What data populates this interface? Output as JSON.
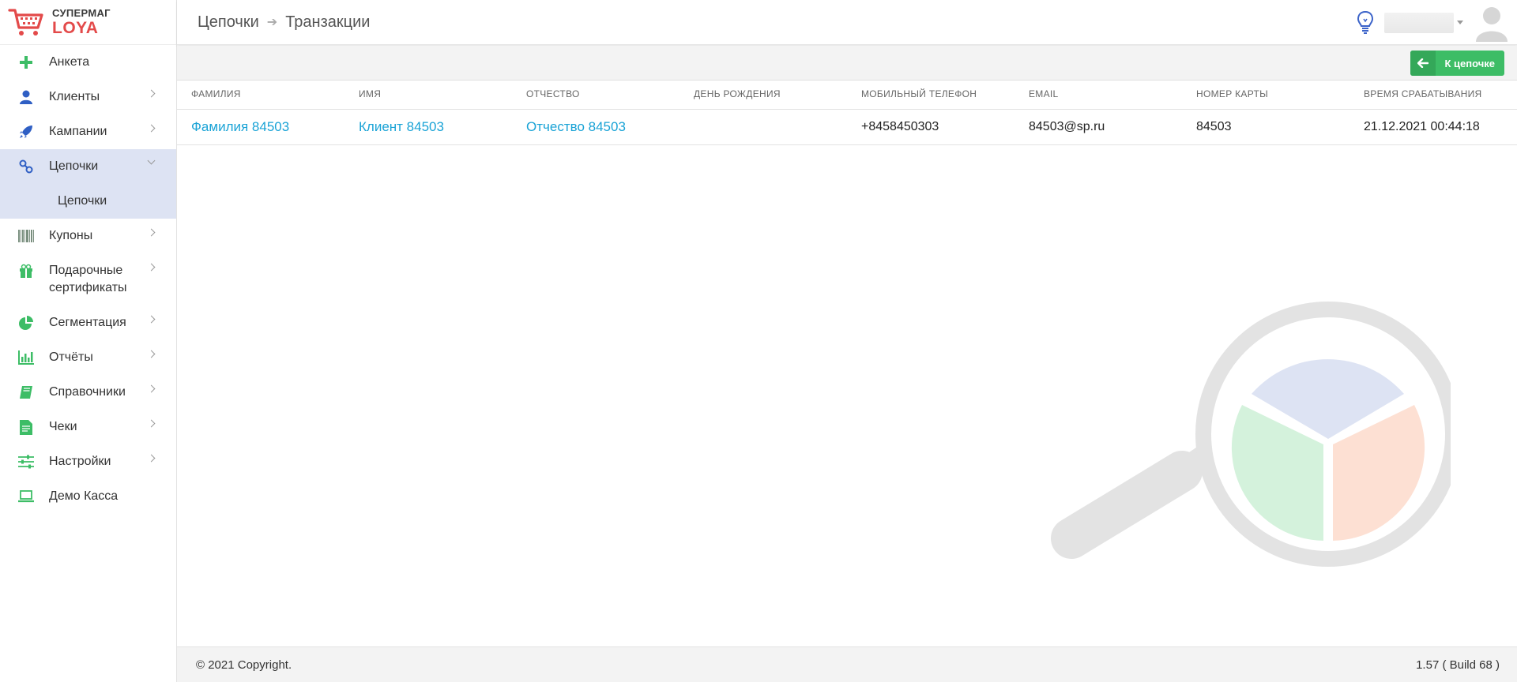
{
  "logo": {
    "line1": "СУПЕРМАГ",
    "line2": "LOYA"
  },
  "sidebar": {
    "items": [
      {
        "label": "Анкета",
        "icon": "plus-icon",
        "has_chevron": false
      },
      {
        "label": "Клиенты",
        "icon": "user-icon",
        "has_chevron": true
      },
      {
        "label": "Кампании",
        "icon": "rocket-icon",
        "has_chevron": true
      },
      {
        "label": "Цепочки",
        "icon": "chain-icon",
        "has_chevron": true,
        "active": true
      },
      {
        "label": "Купоны",
        "icon": "barcode-icon",
        "has_chevron": true
      },
      {
        "label": "Подарочные сертификаты",
        "icon": "gift-icon",
        "has_chevron": true
      },
      {
        "label": "Сегментация",
        "icon": "pie-chart-icon",
        "has_chevron": true
      },
      {
        "label": "Отчёты",
        "icon": "bar-chart-icon",
        "has_chevron": true
      },
      {
        "label": "Справочники",
        "icon": "book-icon",
        "has_chevron": true
      },
      {
        "label": "Чеки",
        "icon": "receipt-icon",
        "has_chevron": true
      },
      {
        "label": "Настройки",
        "icon": "sliders-icon",
        "has_chevron": true
      },
      {
        "label": "Демо Касса",
        "icon": "laptop-icon",
        "has_chevron": false
      }
    ],
    "submenu": {
      "label": "Цепочки"
    }
  },
  "header": {
    "breadcrumb": [
      "Цепочки",
      "Транзакции"
    ]
  },
  "toolbar": {
    "back_label": "К цепочке"
  },
  "table": {
    "columns": [
      "ФАМИЛИЯ",
      "ИМЯ",
      "ОТЧЕСТВО",
      "ДЕНЬ РОЖДЕНИЯ",
      "МОБИЛЬНЫЙ ТЕЛЕФОН",
      "EMAIL",
      "НОМЕР КАРТЫ",
      "ВРЕМЯ СРАБАТЫВАНИЯ"
    ],
    "rows": [
      [
        "Фамилия 84503",
        "Клиент 84503",
        "Отчество 84503",
        "",
        "+8458450303",
        "84503@sp.ru",
        "84503",
        "21.12.2021 00:44:18"
      ]
    ]
  },
  "footer": {
    "copyright": "© 2021 Copyright.",
    "version": "1.57 ( Build 68 )"
  },
  "colors": {
    "accent_green": "#3dbd66",
    "link_blue": "#1aa3d6",
    "brand_red": "#e34a4a",
    "active_bg": "#dde3f3"
  }
}
